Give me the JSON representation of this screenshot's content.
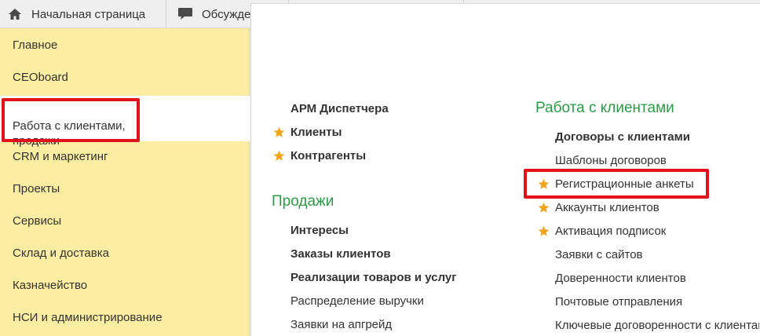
{
  "tabs": {
    "home_label": "Начальная страница",
    "discuss_label": "Обсужде"
  },
  "sidebar": {
    "items": [
      {
        "label": "Главное"
      },
      {
        "label": "CEOboard"
      },
      {
        "label": "Работа с клиентами,\nпродажи",
        "active": true
      },
      {
        "label": "CRM и маркетинг"
      },
      {
        "label": "Проекты"
      },
      {
        "label": "Сервисы"
      },
      {
        "label": "Склад и доставка"
      },
      {
        "label": "Казначейство"
      },
      {
        "label": "НСИ и администрирование"
      }
    ]
  },
  "main": {
    "left_col": {
      "top_links": [
        {
          "label": "АРМ Диспетчера",
          "bold": true,
          "starred": false
        },
        {
          "label": "Клиенты",
          "bold": true,
          "starred": true
        },
        {
          "label": "Контрагенты",
          "bold": true,
          "starred": true
        }
      ],
      "sales_title": "Продажи",
      "sales_links": [
        {
          "label": "Интересы",
          "bold": true
        },
        {
          "label": "Заказы клиентов",
          "bold": true
        },
        {
          "label": "Реализации товаров и услуг",
          "bold": true
        },
        {
          "label": "Распределение выручки",
          "bold": false
        },
        {
          "label": "Заявки на апгрейд",
          "bold": false
        }
      ]
    },
    "right_col": {
      "title": "Работа с клиентами",
      "links": [
        {
          "label": "Договоры с клиентами",
          "bold": true,
          "starred": false
        },
        {
          "label": "Шаблоны договоров",
          "bold": false,
          "starred": false
        },
        {
          "label": "Регистрационные анкеты",
          "bold": false,
          "starred": true
        },
        {
          "label": "Аккаунты клиентов",
          "bold": false,
          "starred": true
        },
        {
          "label": "Активация подписок",
          "bold": false,
          "starred": true
        },
        {
          "label": "Заявки с сайтов",
          "bold": false,
          "starred": false
        },
        {
          "label": "Доверенности клиентов",
          "bold": false,
          "starred": false
        },
        {
          "label": "Почтовые отправления",
          "bold": false,
          "starred": false
        },
        {
          "label": "Ключевые договоренности с клиентами",
          "bold": false,
          "starred": false
        }
      ]
    }
  },
  "colors": {
    "sidebar_bg": "#fbeda1",
    "section_title": "#2b9a46",
    "star": "#f2a51b",
    "highlight": "#e3111b"
  },
  "icons": {
    "home_tab": "home-icon",
    "discuss_tab": "chat-bubble-icon",
    "favorite": "star-icon"
  }
}
